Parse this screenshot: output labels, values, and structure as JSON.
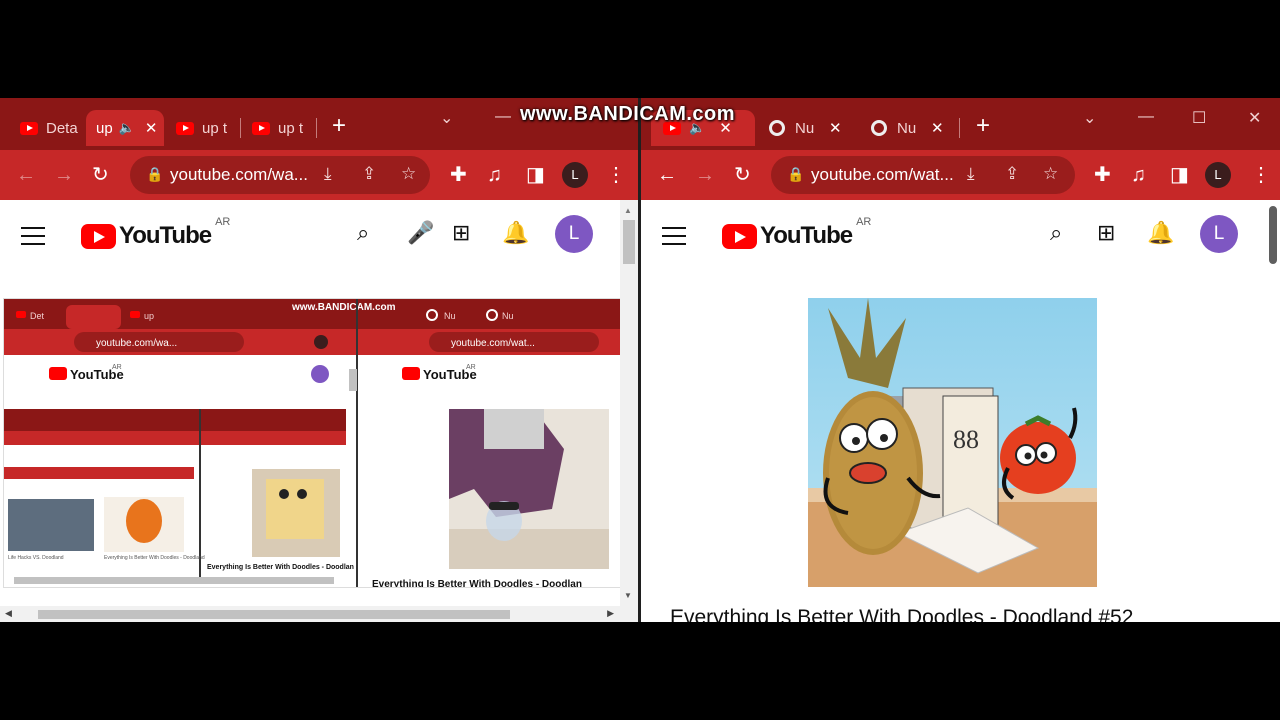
{
  "watermark": "www.BANDICAM.com",
  "left_window": {
    "tabs": [
      {
        "title": "Deta",
        "favicon": "youtube-icon",
        "active": false
      },
      {
        "title": "up",
        "favicon": "youtube-icon",
        "active": true,
        "audio": true
      },
      {
        "title": "up t",
        "favicon": "youtube-icon",
        "active": false
      },
      {
        "title": "up t",
        "favicon": "youtube-icon",
        "active": false
      }
    ],
    "url": "youtube.com/wa...",
    "profile_letter": "L",
    "youtube": {
      "logo_text": "YouTube",
      "region": "AR",
      "avatar_letter": "L"
    },
    "mirror": {
      "url": "youtube.com/wa...",
      "url2": "youtube.com/wat...",
      "tabs": [
        "Det",
        "up",
        "Nu",
        "Nu"
      ],
      "region": "AR",
      "title_cut": "Everything Is Better With Doodles - Doodlan",
      "title_cut_small": "Everything Is Better With Doodles - Doodlan",
      "inner_caption": "Everything Is Better With Doodles - Doodland",
      "inner_small_caption": "Life Hacks VS. Doodland"
    }
  },
  "right_window": {
    "tabs": [
      {
        "title": "",
        "favicon": "youtube-icon",
        "active": true,
        "audio": true
      },
      {
        "title": "Nu",
        "favicon": "chrome-icon",
        "active": false
      },
      {
        "title": "Nu",
        "favicon": "chrome-icon",
        "active": false
      }
    ],
    "url": "youtube.com/wat...",
    "profile_letter": "L",
    "youtube": {
      "logo_text": "YouTube",
      "region": "AR",
      "avatar_letter": "L"
    },
    "video_title": "Everything Is Better With Doodles - Doodland #52"
  },
  "colors": {
    "tabbar": "#8b1716",
    "toolbar": "#c62828",
    "yt_red": "#ff0000",
    "avatar": "#7e57c2"
  }
}
